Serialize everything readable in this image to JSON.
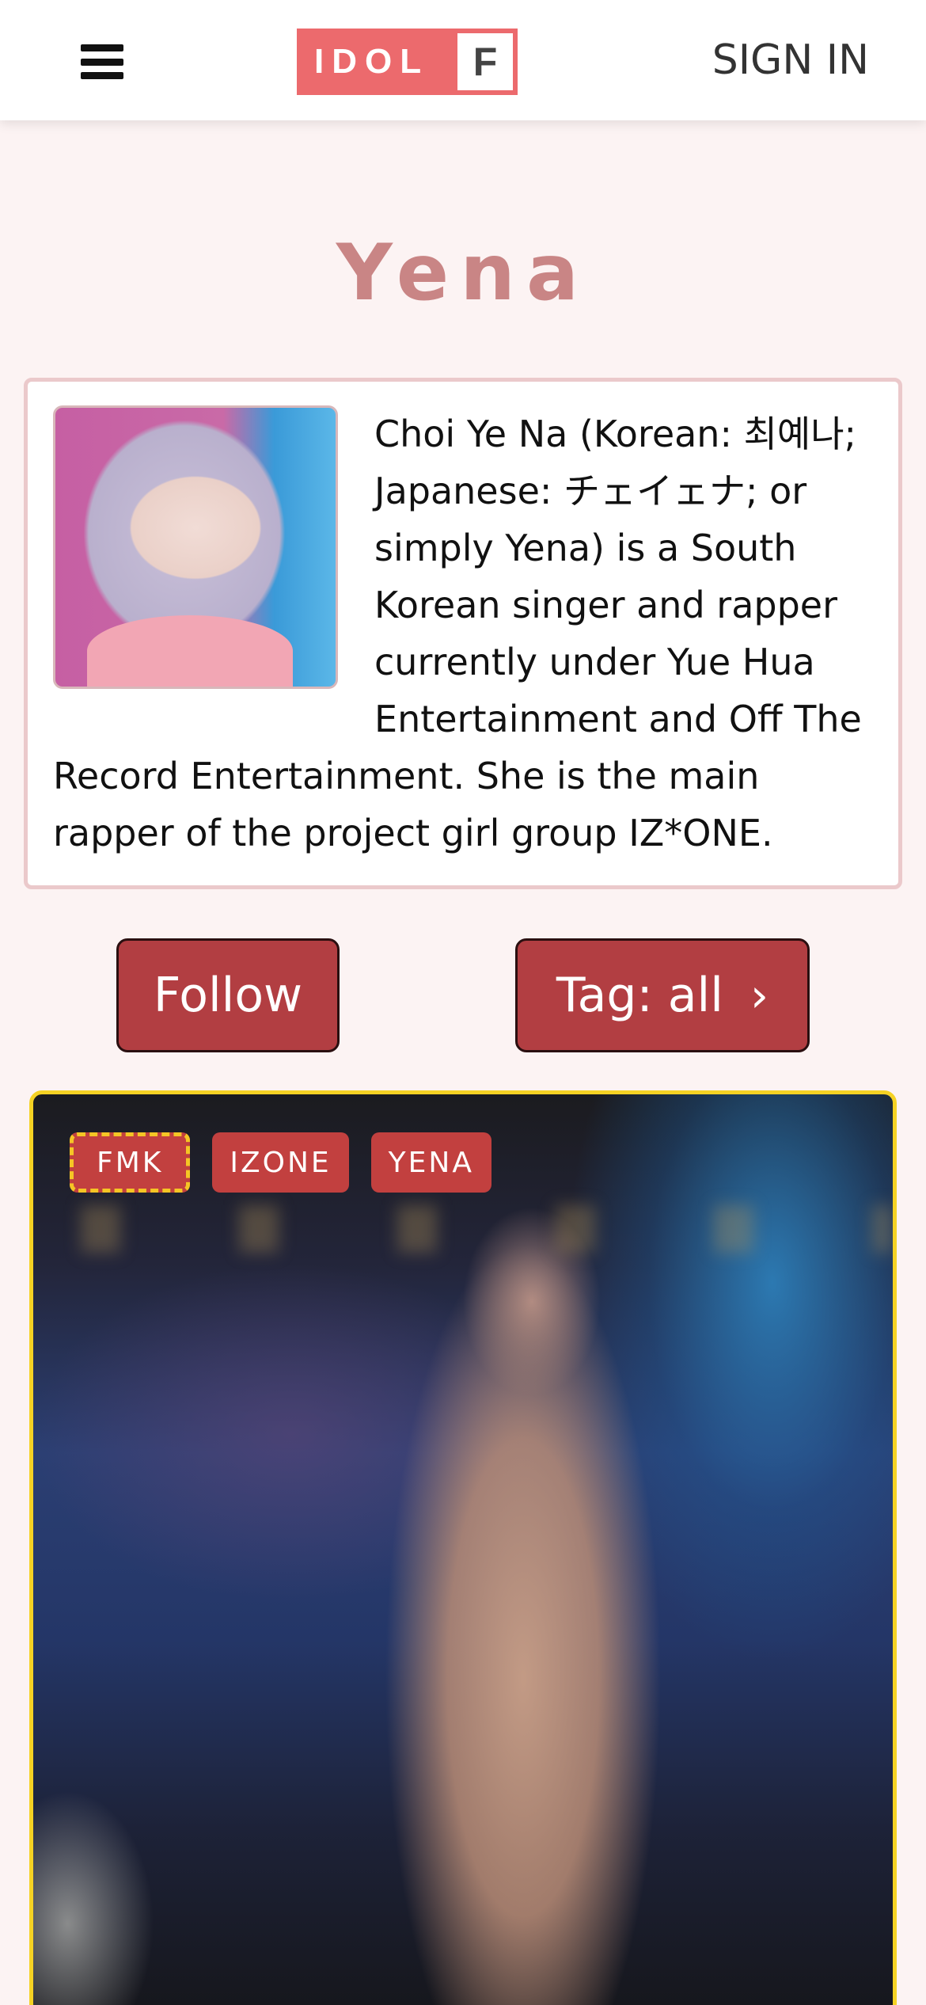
{
  "header": {
    "logo_text": "IDOL",
    "logo_box_letter": "F",
    "signin_label": "SIGN IN"
  },
  "page": {
    "title": "Yena"
  },
  "bio": {
    "text": "Choi Ye Na (Korean: 최예나; Japanese: チェイェナ; or simply Yena) is a South Korean singer and rapper currently under Yue Hua Entertainment and Off The Record Entertainment. She is the main rapper of the project girl group IZ*ONE."
  },
  "actions": {
    "follow_label": "Follow",
    "tag_label": "Tag: all",
    "tag_chevron": "›"
  },
  "post": {
    "tags": [
      "FMK",
      "IZONE",
      "YENA"
    ]
  },
  "colors": {
    "brand": "#ec6a6d",
    "button": "#b23e42",
    "title": "#c98585",
    "highlight": "#f5d224",
    "background": "#fcf3f3"
  }
}
